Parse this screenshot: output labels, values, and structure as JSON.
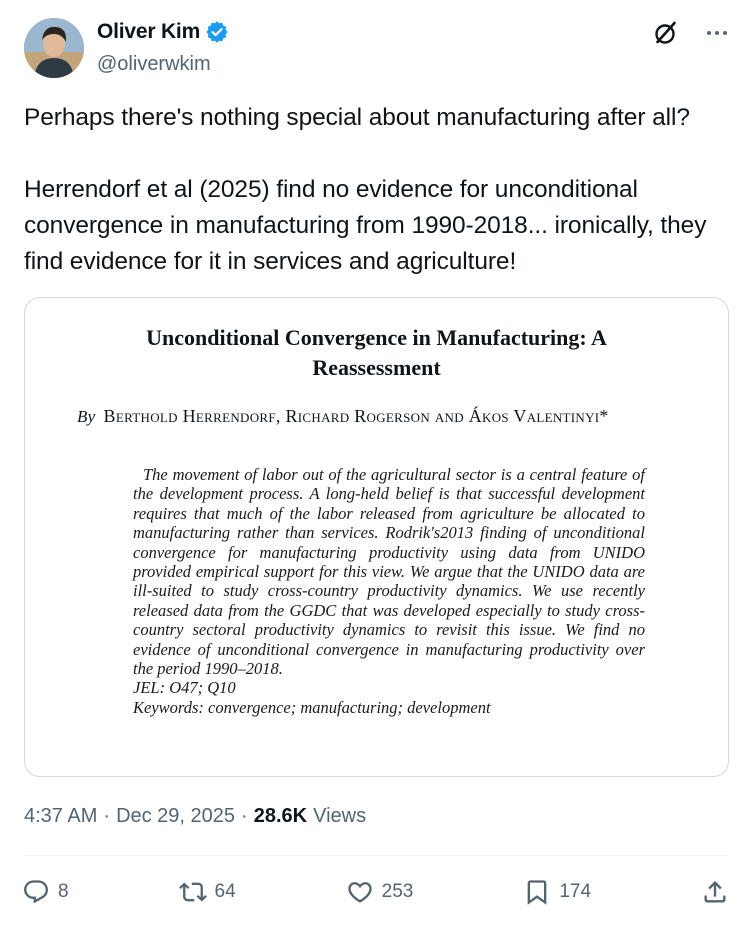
{
  "author": {
    "name": "Oliver Kim",
    "handle": "@oliverwkim",
    "verified": true,
    "accent_color": "#1d9bf0"
  },
  "tweet": {
    "paragraphs": [
      "Perhaps there's nothing special about manufacturing after all?",
      "Herrendorf et al (2025) find no evidence for unconditional convergence in manufacturing from 1990-2018... ironically, they find evidence for it in services and agriculture!"
    ]
  },
  "paper": {
    "title_line1": "Unconditional Convergence in Manufacturing: A",
    "title_line2": "Reassessment",
    "by": "By",
    "authors": "Berthold Herrendorf, Richard Rogerson and Ákos Valentinyi*",
    "abstract": "The movement of labor out of the agricultural sector is a central feature of the development process. A long-held belief is that successful development requires that much of the labor released from agriculture be allocated to manufacturing rather than services. Rodrik's2013 finding of unconditional convergence for manufacturing productivity using data from UNIDO provided empirical support for this view. We argue that the UNIDO data are ill-suited to study cross-country productivity dynamics. We use recently released data from the GGDC that was developed especially to study cross-country sectoral productivity dynamics to revisit this issue. We find no evidence of unconditional convergence in manufacturing productivity over the period 1990–2018.",
    "jel": "JEL: O47; Q10",
    "keywords": "Keywords: convergence; manufacturing; development"
  },
  "meta": {
    "time": "4:37 AM",
    "separator": "·",
    "date": "Dec 29, 2025",
    "views_count": "28.6K",
    "views_label": "Views"
  },
  "actions": {
    "replies": "8",
    "reposts": "64",
    "likes": "253",
    "bookmarks": "174"
  },
  "icons": {
    "top": [
      "grok-icon",
      "more-icon"
    ],
    "actions": [
      "reply-icon",
      "repost-icon",
      "like-icon",
      "bookmark-icon",
      "share-icon"
    ]
  }
}
